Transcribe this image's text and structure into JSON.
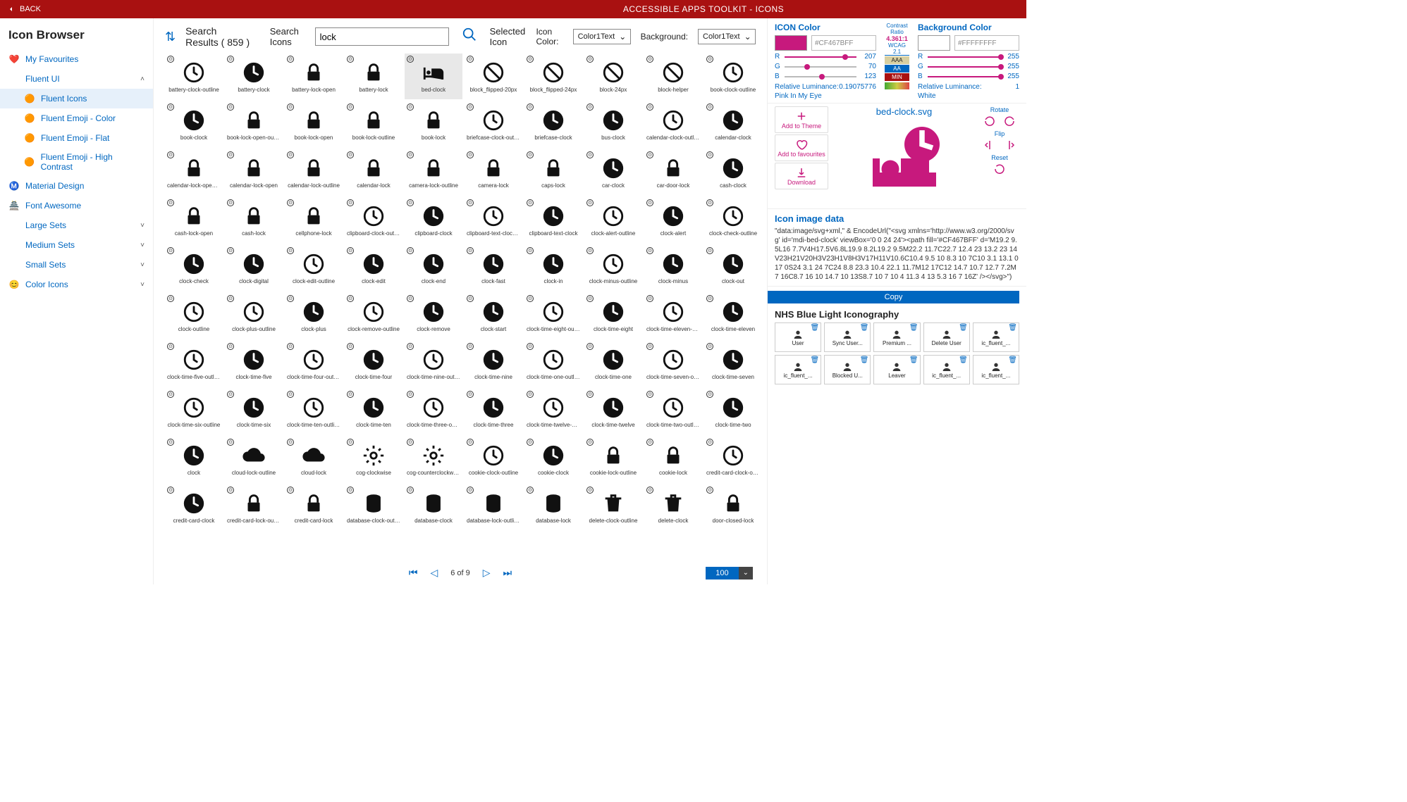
{
  "header": {
    "back": "BACK",
    "title": "ACCESSIBLE APPS TOOLKIT - ICONS"
  },
  "sidebar": {
    "heading": "Icon Browser",
    "items": [
      {
        "label": "My Favourites",
        "icon": "heart"
      },
      {
        "label": "Fluent UI",
        "expand": true
      },
      {
        "label": "Fluent Icons",
        "sub": true,
        "active": true
      },
      {
        "label": "Fluent Emoji - Color",
        "sub": true
      },
      {
        "label": "Fluent Emoji - Flat",
        "sub": true
      },
      {
        "label": "Fluent Emoji - High Contrast",
        "sub": true
      },
      {
        "label": "Material Design",
        "icon": "md"
      },
      {
        "label": "Font Awesome",
        "icon": "fa"
      },
      {
        "label": "Large Sets",
        "expand": false
      },
      {
        "label": "Medium Sets",
        "expand": false
      },
      {
        "label": "Small Sets",
        "expand": false
      },
      {
        "label": "Color Icons",
        "icon": "smile",
        "expand": false
      }
    ]
  },
  "toolbar": {
    "results_label": "Search Results ( 859 )",
    "search_label": "Search Icons",
    "search_value": "lock",
    "selected_label": "Selected Icon",
    "iconcolor_label": "Icon Color:",
    "iconcolor_value": "Color1Text",
    "bg_label": "Background:",
    "bg_value": "Color1Text"
  },
  "grid": [
    "battery-clock-outline",
    "battery-clock",
    "battery-lock-open",
    "battery-lock",
    "bed-clock",
    "block_flipped-20px",
    "block_flipped-24px",
    "block-24px",
    "block-helper",
    "book-clock-outline",
    "book-clock",
    "book-lock-open-outline",
    "book-lock-open",
    "book-lock-outline",
    "book-lock",
    "briefcase-clock-outline",
    "briefcase-clock",
    "bus-clock",
    "calendar-clock-outline",
    "calendar-clock",
    "calendar-lock-open-outline",
    "calendar-lock-open",
    "calendar-lock-outline",
    "calendar-lock",
    "camera-lock-outline",
    "camera-lock",
    "caps-lock",
    "car-clock",
    "car-door-lock",
    "cash-clock",
    "cash-lock-open",
    "cash-lock",
    "cellphone-lock",
    "clipboard-clock-outline",
    "clipboard-clock",
    "clipboard-text-clock-outline",
    "clipboard-text-clock",
    "clock-alert-outline",
    "clock-alert",
    "clock-check-outline",
    "clock-check",
    "clock-digital",
    "clock-edit-outline",
    "clock-edit",
    "clock-end",
    "clock-fast",
    "clock-in",
    "clock-minus-outline",
    "clock-minus",
    "clock-out",
    "clock-outline",
    "clock-plus-outline",
    "clock-plus",
    "clock-remove-outline",
    "clock-remove",
    "clock-start",
    "clock-time-eight-outline",
    "clock-time-eight",
    "clock-time-eleven-outline",
    "clock-time-eleven",
    "clock-time-five-outline",
    "clock-time-five",
    "clock-time-four-outline",
    "clock-time-four",
    "clock-time-nine-outline",
    "clock-time-nine",
    "clock-time-one-outline",
    "clock-time-one",
    "clock-time-seven-outline",
    "clock-time-seven",
    "clock-time-six-outline",
    "clock-time-six",
    "clock-time-ten-outline",
    "clock-time-ten",
    "clock-time-three-outline",
    "clock-time-three",
    "clock-time-twelve-outline",
    "clock-time-twelve",
    "clock-time-two-outline",
    "clock-time-two",
    "clock",
    "cloud-lock-outline",
    "cloud-lock",
    "cog-clockwise",
    "cog-counterclockwise",
    "cookie-clock-outline",
    "cookie-clock",
    "cookie-lock-outline",
    "cookie-lock",
    "credit-card-clock-outline",
    "credit-card-clock",
    "credit-card-lock-outline",
    "credit-card-lock",
    "database-clock-outline",
    "database-clock",
    "database-lock-outline",
    "database-lock",
    "delete-clock-outline",
    "delete-clock",
    "door-closed-lock"
  ],
  "selected_index": 4,
  "pager": {
    "page": "6 of 9",
    "count": "100"
  },
  "panel": {
    "icon_color": {
      "title": "ICON Color",
      "swatch": "#c7197d",
      "hex": "#CF467BFF",
      "r": 207,
      "g": 70,
      "b": 123,
      "lum_label": "Relative Luminance:",
      "lum": "0.19075776",
      "name": "Pink In My Eye"
    },
    "bg_color": {
      "title": "Background Color",
      "swatch": "#ffffff",
      "hex": "#FFFFFFFF",
      "r": 255,
      "g": 255,
      "b": 255,
      "lum_label": "Relative Luminance:",
      "lum": "1",
      "name": "White"
    },
    "contrast": {
      "hdr": "Contrast Ratio",
      "ratio": "4.361:1",
      "wcag": "WCAG 2.1",
      "aaa": "AAA",
      "aa": "AA",
      "min": "MIN"
    },
    "preview": {
      "filename": "bed-clock.svg",
      "add_theme": "Add to Theme",
      "add_fav": "Add to favourites",
      "download": "Download",
      "rotate": "Rotate",
      "flip": "Flip",
      "reset": "Reset"
    },
    "svgdata": {
      "title": "Icon image data",
      "text": "\"data:image/svg+xml,\" & EncodeUrl(\"<svg xmlns='http://www.w3.org/2000/svg' id='mdi-bed-clock' viewBox='0 0 24 24'><path fill='#CF467BFF'  d='M19.2 9.5L16 7.7V4H17.5V6.8L19.9 8.2L19.2 9.5M22.2 11.7C22.7 12.4 23 13.2 23 14V23H21V20H3V23H1V8H3V17H11V10.6C10.4 9.5 10 8.3 10 7C10 3.1 13.1 0 17 0S24 3.1 24 7C24 8.8 23.3 10.4 22.1 11.7M12 17C12 14.7 10.7 12.7 7.2M7 16C8.7 16 10 14.7 10 13S8.7 10 7 10 4 11.3 4 13 5.3 16 7 16Z' /></svg>\")"
    },
    "copy": "Copy",
    "nhs": {
      "title": "NHS Blue Light Iconography",
      "items": [
        "User",
        "Sync User...",
        "Premium ...",
        "Delete User",
        "ic_fluent_...",
        "ic_fluent_...",
        "Blocked U...",
        "Leaver",
        "ic_fluent_...",
        "ic_fluent_..."
      ]
    }
  }
}
